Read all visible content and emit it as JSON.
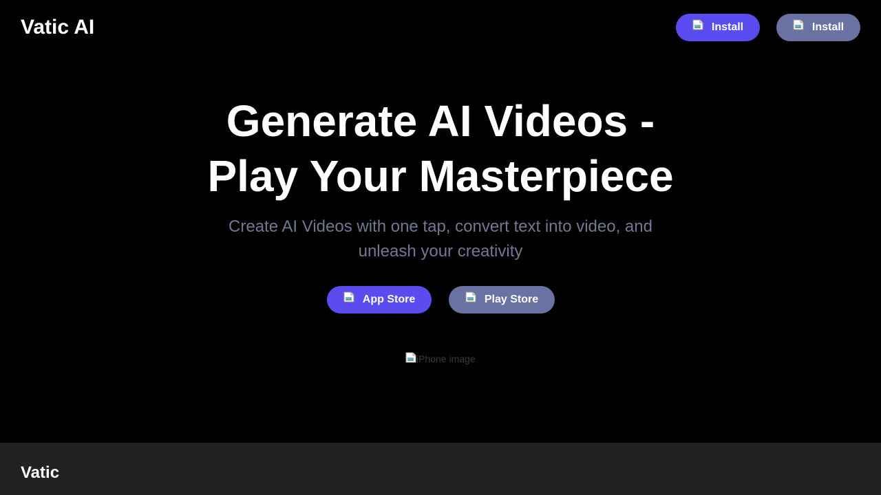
{
  "brand": {
    "name": "Vatic AI"
  },
  "header": {
    "install_primary": {
      "label": "Install",
      "icon": "broken-image-icon",
      "color": "#5b4cf0"
    },
    "install_secondary": {
      "label": "Install",
      "icon": "broken-image-icon",
      "color": "#6a72a4"
    }
  },
  "hero": {
    "title_line1": "Generate AI Videos -",
    "title_line2": "Play Your Masterpiece",
    "subtitle": "Create AI Videos with one tap, convert text into video, and unleash your creativity",
    "app_store_label": "App Store",
    "play_store_label": "Play Store",
    "phone_image_alt": "iPhone image"
  },
  "footer": {
    "brand": "Vatic"
  },
  "colors": {
    "background": "#000000",
    "footer_background": "#222222",
    "primary_button": "#5b4cf0",
    "secondary_button": "#6a72a4",
    "subtitle_text": "#737791"
  }
}
